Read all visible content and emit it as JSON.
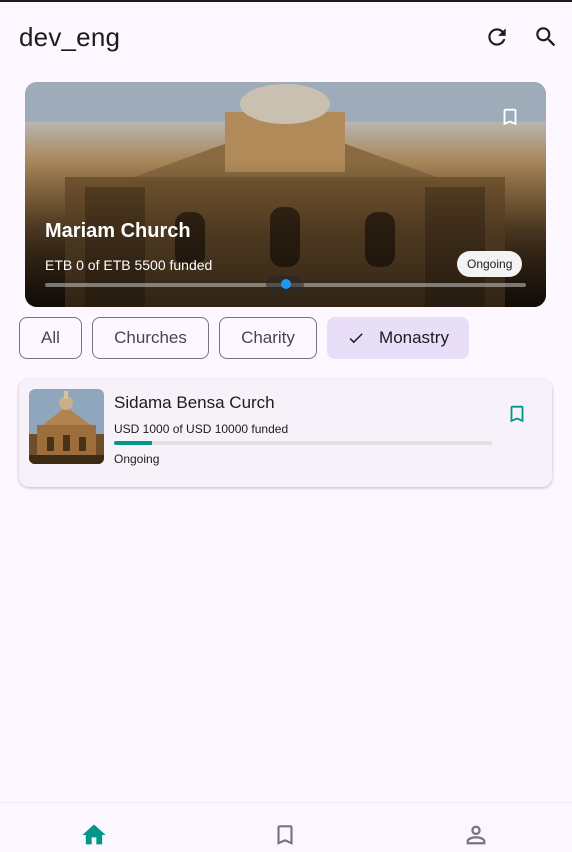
{
  "app": {
    "title": "dev_eng"
  },
  "colors": {
    "accent": "#009688",
    "chip_selected_bg": "#e8def8",
    "indicator": "#2196f3"
  },
  "icons": {
    "refresh": "refresh-icon",
    "search": "search-icon",
    "bookmark": "bookmark-outline-icon",
    "home": "home-icon",
    "profile": "person-icon",
    "check": "check-icon"
  },
  "featured": {
    "title": "Mariam Church",
    "funded_text": "ETB 0 of ETB 5500 funded",
    "status": "Ongoing",
    "progress": 0,
    "page_index": 1,
    "page_count": 1
  },
  "filters": {
    "all": "All",
    "churches": "Churches",
    "charity": "Charity",
    "monastry": "Monastry",
    "selected": "Monastry"
  },
  "projects": [
    {
      "title": "Sidama Bensa Curch",
      "funded_text": "USD 1000 of USD 10000 funded",
      "status": "Ongoing",
      "progress": 0.1
    }
  ],
  "nav": {
    "items": [
      "home",
      "saved",
      "profile"
    ],
    "selected": "home"
  }
}
